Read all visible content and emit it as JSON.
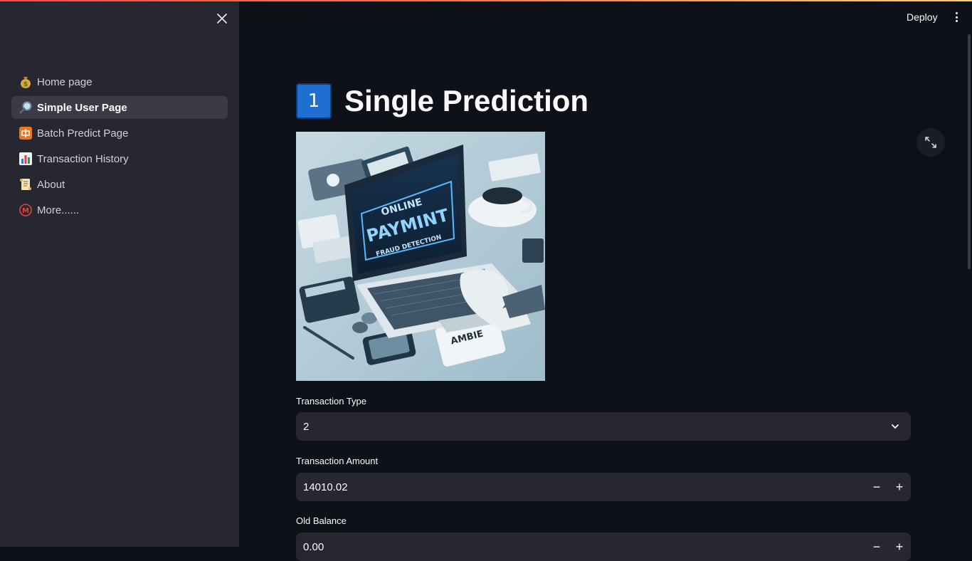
{
  "sidebar": {
    "items": [
      {
        "icon": "money-bag-icon",
        "label": "Home page",
        "active": false
      },
      {
        "icon": "magnifier-icon",
        "label": "Simple User Page",
        "active": true
      },
      {
        "icon": "batch-icon",
        "label": "Batch Predict Page",
        "active": false
      },
      {
        "icon": "bar-chart-icon",
        "label": "Transaction History",
        "active": false
      },
      {
        "icon": "scroll-icon",
        "label": "About",
        "active": false
      },
      {
        "icon": "m-circle-icon",
        "label": "More......",
        "active": false
      }
    ]
  },
  "header": {
    "deploy_label": "Deploy"
  },
  "main": {
    "title_emoji": "1",
    "title": "Single Prediction",
    "image": {
      "line1": "ONLINE",
      "line2": "PAYMINT",
      "line3": "FRAUD DETECTION",
      "card_text": "AMBIE"
    },
    "fields": {
      "type_label": "Transaction Type",
      "type_value": "2",
      "amount_label": "Transaction Amount",
      "amount_value": "14010.02",
      "old_balance_label": "Old Balance",
      "old_balance_value": "0.00"
    }
  },
  "colors": {
    "background": "#0e1117",
    "sidebar": "#262730",
    "input": "#262730",
    "accent": "#ff4b4b"
  }
}
